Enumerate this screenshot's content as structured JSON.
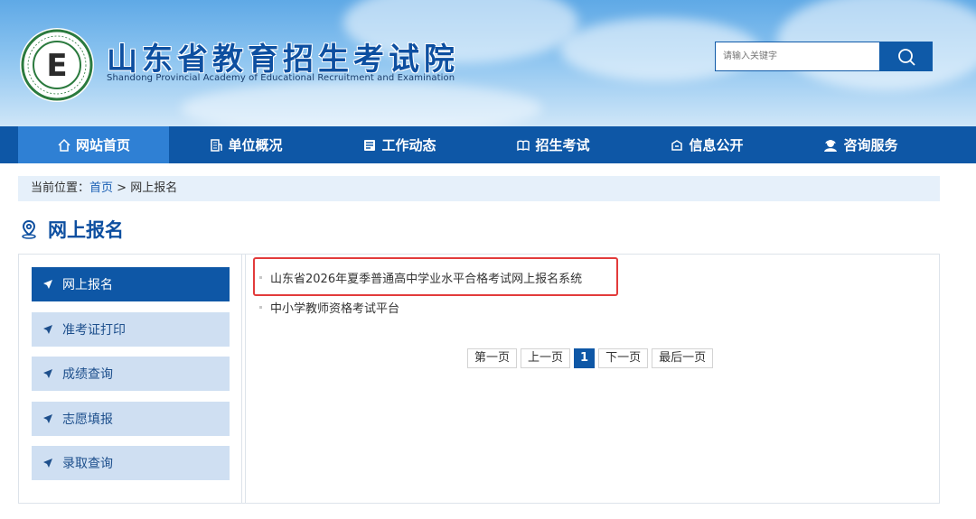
{
  "header": {
    "title_cn": "山东省教育招生考试院",
    "title_en": "Shandong Provincial Academy of Educational Recruitment and Examination",
    "emblem_letter": "E",
    "search_placeholder": "请输入关键字",
    "search_icon": "search-icon"
  },
  "nav": {
    "items": [
      {
        "label": "网站首页",
        "icon": "home-icon",
        "active": true
      },
      {
        "label": "单位概况",
        "icon": "building-icon",
        "active": false
      },
      {
        "label": "工作动态",
        "icon": "news-icon",
        "active": false
      },
      {
        "label": "招生考试",
        "icon": "book-icon",
        "active": false
      },
      {
        "label": "信息公开",
        "icon": "info-box-icon",
        "active": false
      },
      {
        "label": "咨询服务",
        "icon": "support-icon",
        "active": false
      }
    ]
  },
  "breadcrumb": {
    "prefix": "当前位置：",
    "home": "首页",
    "separator": " > ",
    "current": "网上报名"
  },
  "section": {
    "title": "网上报名",
    "icon": "location-pin-icon"
  },
  "sidebar": {
    "items": [
      {
        "label": "网上报名",
        "active": true
      },
      {
        "label": "准考证打印",
        "active": false
      },
      {
        "label": "成绩查询",
        "active": false
      },
      {
        "label": "志愿填报",
        "active": false
      },
      {
        "label": "录取查询",
        "active": false
      }
    ]
  },
  "content": {
    "links": [
      "山东省2026年夏季普通高中学业水平合格考试网上报名系统",
      "中小学教师资格考试平台"
    ]
  },
  "pager": {
    "first": "第一页",
    "prev": "上一页",
    "current": "1",
    "next": "下一页",
    "last": "最后一页"
  },
  "colors": {
    "primary": "#0e57a6",
    "nav_active": "#2f80d4",
    "sidebar_item": "#cfdff2",
    "highlight": "#e23b3b"
  }
}
